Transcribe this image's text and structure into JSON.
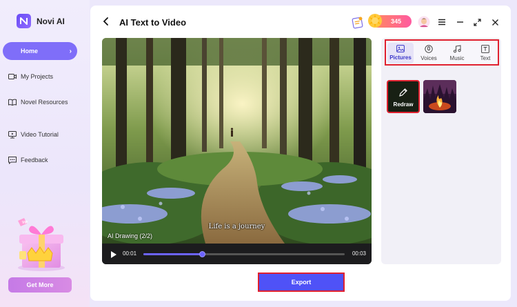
{
  "app": {
    "name": "Novi AI"
  },
  "sidebar": {
    "items": [
      {
        "label": "Home",
        "icon": "home"
      },
      {
        "label": "My Projects",
        "icon": "video-folder-icon"
      },
      {
        "label": "Novel Resources",
        "icon": "book-icon"
      },
      {
        "label": "Video Tutorial",
        "icon": "tutorial-icon"
      },
      {
        "label": "Feedback",
        "icon": "chat-icon"
      }
    ],
    "promo_badge": "VIP",
    "get_more_label": "Get More"
  },
  "header": {
    "title": "AI Text to Video",
    "credits": "345"
  },
  "video": {
    "subtitle": "Life is a journey",
    "drawing_label": "AI Drawing",
    "drawing_index": "(2/2)",
    "time_current": "00:01",
    "time_total": "00:03",
    "progress": 0.29
  },
  "export_label": "Export",
  "right_panel": {
    "tabs": [
      {
        "label": "Pictures",
        "icon": "image-icon"
      },
      {
        "label": "Voices",
        "icon": "voice-icon"
      },
      {
        "label": "Music",
        "icon": "music-icon"
      },
      {
        "label": "Text",
        "icon": "text-icon"
      }
    ],
    "redraw_label": "Redraw"
  },
  "colors": {
    "accent": "#7f6ef9",
    "export": "#4f52f7",
    "highlight": "#e0202e"
  }
}
